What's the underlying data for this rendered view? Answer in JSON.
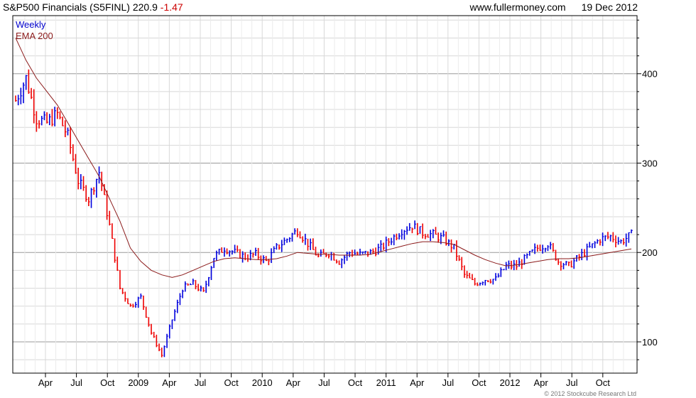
{
  "header": {
    "title": "S&P500 Financials (S5FINL)",
    "last": "220.9",
    "change": "-1.47",
    "site": "www.fullermoney.com",
    "date": "19 Dec 2012"
  },
  "legend": {
    "period": "Weekly",
    "ema": "EMA 200"
  },
  "footer": {
    "copyright": "© 2012 Stockcube Research Ltd"
  },
  "colors": {
    "up": "#0000dd",
    "down": "#ee0000",
    "ema": "#8b1a1a",
    "grid": "#d8d8d8"
  },
  "chart_data": {
    "type": "line",
    "chart_style": "ohlc-bars",
    "title": "S&P500 Financials (S5FINL)",
    "ylim": [
      65,
      465
    ],
    "yticks": [
      100,
      200,
      300,
      400
    ],
    "xtick_labels": [
      "Apr",
      "Jul",
      "Oct",
      "2009",
      "Apr",
      "Jul",
      "Oct",
      "2010",
      "Apr",
      "Jul",
      "Oct",
      "2011",
      "Apr",
      "Jul",
      "Oct",
      "2012",
      "Apr",
      "Jul",
      "Oct"
    ],
    "x": [
      "2008-01",
      "2008-02",
      "2008-03",
      "2008-04",
      "2008-05",
      "2008-06",
      "2008-07",
      "2008-08",
      "2008-09",
      "2008-10",
      "2008-11",
      "2008-12",
      "2009-01",
      "2009-02",
      "2009-03",
      "2009-04",
      "2009-05",
      "2009-06",
      "2009-07",
      "2009-08",
      "2009-09",
      "2009-10",
      "2009-11",
      "2009-12",
      "2010-01",
      "2010-02",
      "2010-03",
      "2010-04",
      "2010-05",
      "2010-06",
      "2010-07",
      "2010-08",
      "2010-09",
      "2010-10",
      "2010-11",
      "2010-12",
      "2011-01",
      "2011-02",
      "2011-03",
      "2011-04",
      "2011-05",
      "2011-06",
      "2011-07",
      "2011-08",
      "2011-09",
      "2011-10",
      "2011-11",
      "2011-12",
      "2012-01",
      "2012-02",
      "2012-03",
      "2012-04",
      "2012-05",
      "2012-06",
      "2012-07",
      "2012-08",
      "2012-09",
      "2012-10",
      "2012-11",
      "2012-12"
    ],
    "series": [
      {
        "name": "Weekly",
        "values": [
          370,
          395,
          350,
          345,
          355,
          330,
          280,
          260,
          290,
          230,
          160,
          140,
          150,
          110,
          85,
          125,
          160,
          165,
          155,
          195,
          205,
          200,
          195,
          198,
          190,
          205,
          215,
          225,
          210,
          195,
          200,
          190,
          200,
          198,
          200,
          205,
          215,
          225,
          230,
          222,
          220,
          215,
          205,
          175,
          165,
          170,
          170,
          185,
          185,
          195,
          205,
          210,
          190,
          185,
          195,
          205,
          215,
          218,
          212,
          220
        ]
      },
      {
        "name": "EMA 200",
        "values": [
          440,
          415,
          395,
          380,
          365,
          345,
          325,
          305,
          285,
          260,
          235,
          205,
          190,
          180,
          175,
          172,
          175,
          180,
          185,
          190,
          193,
          194,
          193,
          192,
          192,
          193,
          196,
          200,
          199,
          198,
          198,
          197,
          197,
          197,
          198,
          201,
          204,
          207,
          210,
          212,
          212,
          211,
          209,
          203,
          197,
          192,
          188,
          185,
          186,
          188,
          190,
          192,
          193,
          193,
          194,
          196,
          198,
          200,
          202,
          204
        ]
      }
    ]
  }
}
